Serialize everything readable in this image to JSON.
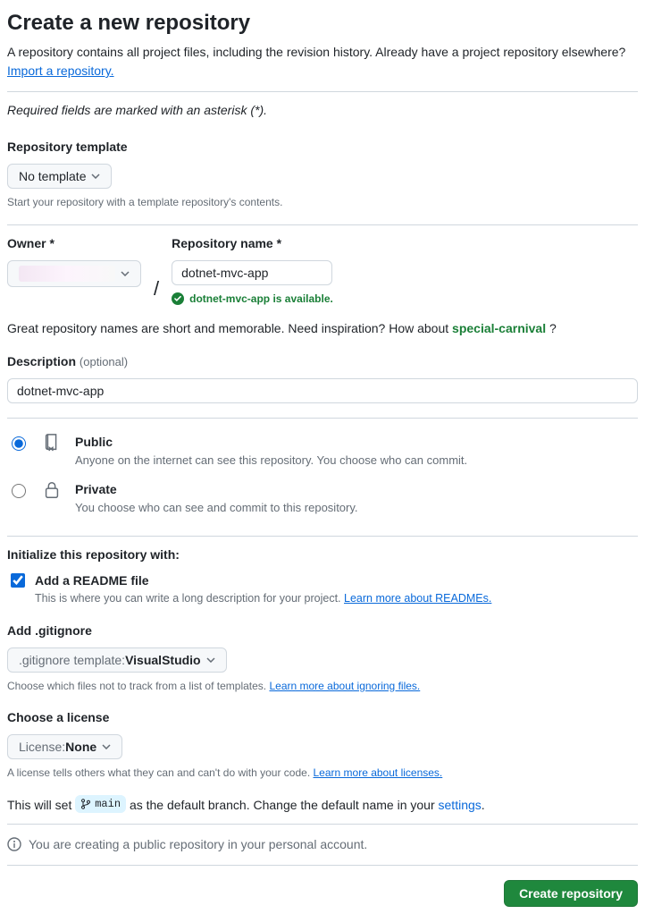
{
  "header": {
    "title": "Create a new repository",
    "subtitle_part1": "A repository contains all project files, including the revision history. Already have a project repository elsewhere? ",
    "import_link": "Import a repository."
  },
  "required_note": "Required fields are marked with an asterisk (*).",
  "template": {
    "label": "Repository template",
    "value": "No template",
    "help": "Start your repository with a template repository's contents."
  },
  "owner": {
    "label": "Owner *"
  },
  "repo": {
    "label": "Repository name *",
    "value": "dotnet-mvc-app",
    "availability": "dotnet-mvc-app is available."
  },
  "suggest": {
    "pre": "Great repository names are short and memorable. Need inspiration? How about ",
    "name": "special-carnival",
    "post": " ?"
  },
  "description": {
    "label": "Description ",
    "optional": "(optional)",
    "value": "dotnet-mvc-app"
  },
  "visibility": {
    "public": {
      "title": "Public",
      "sub": "Anyone on the internet can see this repository. You choose who can commit."
    },
    "private": {
      "title": "Private",
      "sub": "You choose who can see and commit to this repository."
    }
  },
  "init": {
    "heading": "Initialize this repository with:",
    "readme": {
      "title": "Add a README file",
      "sub": "This is where you can write a long description for your project. ",
      "link": "Learn more about READMEs."
    }
  },
  "gitignore": {
    "label": "Add .gitignore",
    "prefix": ".gitignore template: ",
    "value": "VisualStudio",
    "help": "Choose which files not to track from a list of templates. ",
    "link": "Learn more about ignoring files."
  },
  "license": {
    "label": "Choose a license",
    "prefix": "License: ",
    "value": "None",
    "help": "A license tells others what they can and can't do with your code. ",
    "link": "Learn more about licenses."
  },
  "branch": {
    "pre": "This will set ",
    "name": "main",
    "mid": " as the default branch. Change the default name in your ",
    "link": "settings",
    "post": "."
  },
  "info_note": "You are creating a public repository in your personal account.",
  "submit": "Create repository"
}
